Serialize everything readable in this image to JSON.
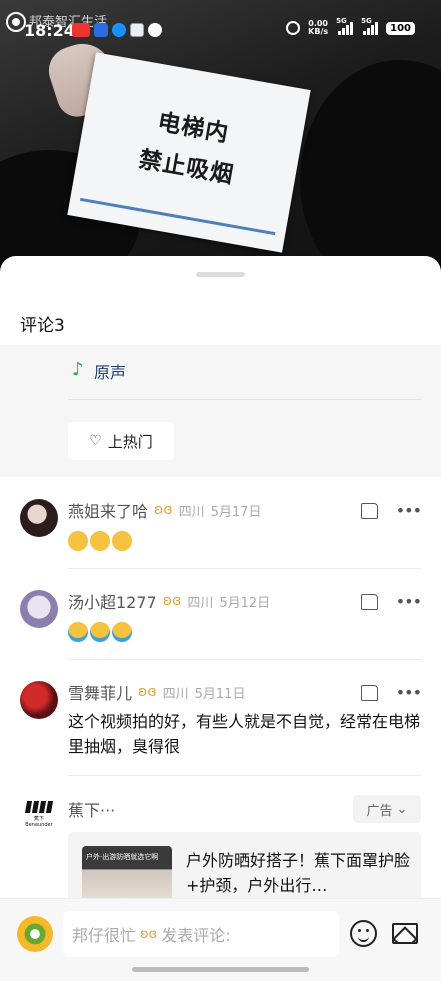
{
  "status_bar": {
    "watermark": "邦泰智汇生活",
    "time": "18:24",
    "net_speed_value": "0.00",
    "net_speed_unit": "KB/s",
    "sim1_label": "5G",
    "sim2_label": "5G",
    "battery": "100"
  },
  "video": {
    "sign_line1": "电梯内",
    "sign_line2": "禁止吸烟"
  },
  "sheet": {
    "title": "评论3",
    "music_label": "原声",
    "hot_button_label": "上热门"
  },
  "comments": [
    {
      "name": "燕姐来了哈",
      "location": "四川",
      "date": "5月17日",
      "text": "",
      "emoji": [
        "smirk",
        "smirk",
        "smirk"
      ]
    },
    {
      "name": "汤小超1277",
      "location": "四川",
      "date": "5月12日",
      "text": "",
      "emoji": [
        "laugh",
        "laugh",
        "laugh"
      ]
    },
    {
      "name": "雪舞菲儿",
      "location": "四川",
      "date": "5月11日",
      "text": "这个视频拍的好，有些人就是不自觉，经常在电梯里抽烟，臭得很",
      "emoji": []
    }
  ],
  "ad": {
    "brand_name": "蕉下···",
    "logo_text": "蕉下 Beneunder",
    "tag": "广告",
    "thumb_caption": "户外·出游防晒就选它啊",
    "title": "户外防晒好搭子！蕉下面罩护脸+护颈，户外出行…"
  },
  "bottom_bar": {
    "user_name": "邦仔很忙",
    "placeholder": "发表评论:"
  },
  "icons": {
    "music": "music-note-icon",
    "hot": "heart-outline-icon",
    "like": "thumbs-up-icon",
    "more": "more-dots-icon",
    "emoji": "emoji-icon",
    "image": "image-icon"
  },
  "colors": {
    "music_note": "#2ab24c",
    "music_label": "#233e73",
    "vip_badge": "#e0a33a"
  }
}
